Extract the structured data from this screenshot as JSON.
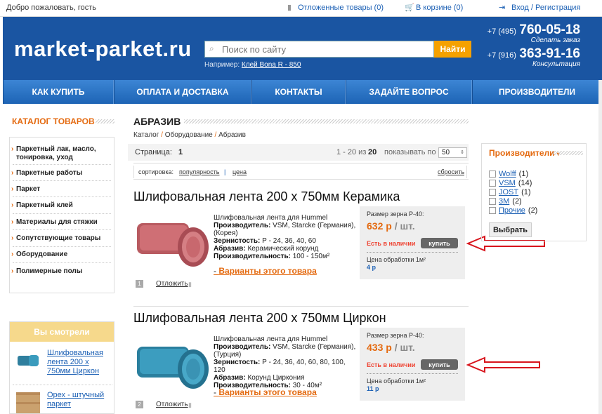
{
  "topbar": {
    "welcome": "Добро пожаловать, гость",
    "deferred": "Отложенные товары (0)",
    "cart": "В корзине (0)",
    "login": "Вход / Регистрация"
  },
  "header": {
    "logo": "market-parket.ru",
    "search_placeholder": "Поиск по сайту",
    "search_button": "Найти",
    "example_prefix": "Например:",
    "example_link": "Клей Bona R - 850",
    "phone1_code": "+7 (495)",
    "phone1_num": "760-05-18",
    "phone1_caption": "Сделать заказ",
    "phone2_code": "+7 (916)",
    "phone2_num": "363-91-16",
    "phone2_caption": "Консультация"
  },
  "nav": [
    "КАК КУПИТЬ",
    "ОПЛАТА И ДОСТАВКА",
    "КОНТАКТЫ",
    "ЗАДАЙТЕ ВОПРОС",
    "ПРОИЗВОДИТЕЛИ"
  ],
  "sidebar": {
    "title": "КАТАЛОГ ТОВАРОВ",
    "items": [
      "Паркетный лак, масло, тонировка, уход",
      "Паркетные работы",
      "Паркет",
      "Паркетный клей",
      "Материалы для стяжки",
      "Сопутствующие товары",
      "Оборудование",
      "Полимерные полы"
    ],
    "seen_title": "Вы смотрели",
    "seen_items": [
      "Шлифовальная лента 200 х 750мм Циркон",
      "Орех - штучный паркет"
    ]
  },
  "main": {
    "title": "АБРАЗИВ",
    "crumbs": [
      "Каталог",
      "Оборудование",
      "Абразив"
    ],
    "page_label": "Страница:",
    "page_num": "1",
    "range": "1 - 20 из",
    "total": "20",
    "per_page_label": "показывать по",
    "per_page": "50",
    "sort_label": "сортировка:",
    "sort_popularity": "популярность",
    "sort_price": "цена",
    "reset": "сбросить"
  },
  "products": [
    {
      "num": "1",
      "title": "Шлифовальная лента 200 х 750мм Керамика",
      "desc": "Шлифовальная лента для Hummel",
      "maker_label": "Производитель:",
      "maker": "VSM, Starcke (Германия), (Корея)",
      "grit_label": "Зернистость:",
      "grit": "Р - 24, 36, 40, 60",
      "abrasive_label": "Абразив:",
      "abrasive": "Керамический корунд",
      "perf_label": "Производительность:",
      "perf": "100 - 150м²",
      "variants": "Варианты этого товара",
      "grain_size": "Размер зерна Р-40:",
      "price": "632 р",
      "unit": "/ шт.",
      "stock": "Есть в наличии",
      "buy": "купить",
      "proc_label": "Цена обработки 1м²",
      "proc_value": "4 р",
      "defer": "Отложить"
    },
    {
      "num": "2",
      "title": "Шлифовальная лента 200 х 750мм Циркон",
      "desc": "Шлифовальная лента для Hummel",
      "maker_label": "Производитель:",
      "maker": "VSM, Starcke (Германия), (Турция)",
      "grit_label": "Зернистость:",
      "grit": "Р - 24, 36, 40, 60, 80, 100, 120",
      "abrasive_label": "Абразив:",
      "abrasive": "Корунд Циркония",
      "perf_label": "Производительность:",
      "perf": "30 - 40м²",
      "variants": "Варианты этого товара",
      "grain_size": "Размер зерна Р-40:",
      "price": "433 р",
      "unit": "/ шт.",
      "stock": "Есть в наличии",
      "buy": "купить",
      "proc_label": "Цена обработки 1м²",
      "proc_value": "11 р",
      "defer": "Отложить"
    }
  ],
  "filter": {
    "title": "Производители",
    "options": [
      {
        "name": "Wolff",
        "count": "(1)"
      },
      {
        "name": "VSM",
        "count": "(14)"
      },
      {
        "name": "JOST",
        "count": "(1)"
      },
      {
        "name": "3M",
        "count": "(2)"
      },
      {
        "name": "Прочие",
        "count": "(2)"
      }
    ],
    "apply": "Выбрать"
  },
  "colors": {
    "header": "#1a55a2",
    "accent": "#e46a10",
    "search_button": "#f5a100",
    "arrow": "#d8141c"
  }
}
